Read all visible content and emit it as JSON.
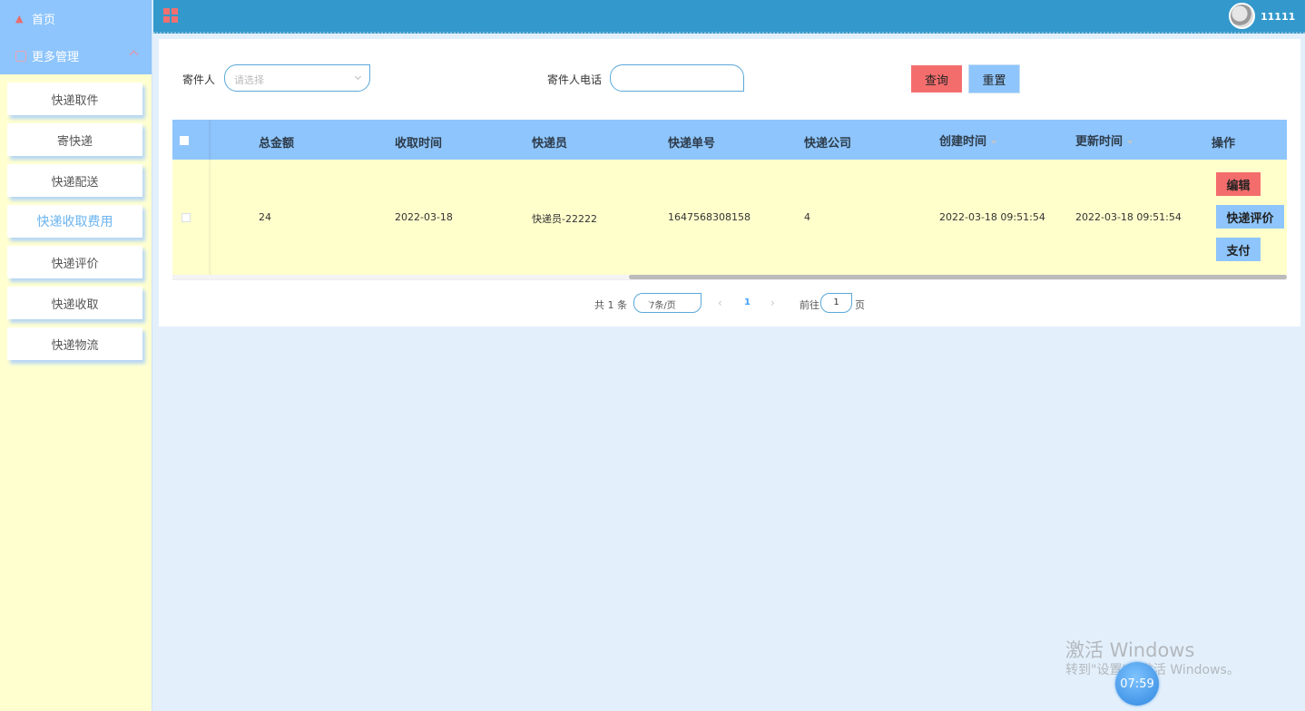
{
  "sidebar": {
    "home": "首页",
    "more": "更多管理",
    "items": [
      {
        "label": "快递取件"
      },
      {
        "label": "寄快递"
      },
      {
        "label": "快递配送"
      },
      {
        "label": "快递收取费用"
      },
      {
        "label": "快递评价"
      },
      {
        "label": "快递收取"
      },
      {
        "label": "快递物流"
      }
    ],
    "active_index": 3
  },
  "topbar": {
    "username": "11111",
    "menu_icon": "grid-icon"
  },
  "filters": {
    "sender_label": "寄件人",
    "sender_placeholder": "请选择",
    "phone_label": "寄件人电话",
    "phone_value": "",
    "search_button": "查询",
    "reset_button": "重置"
  },
  "table": {
    "headers": {
      "total": "总金额",
      "collect_time": "收取时间",
      "courier": "快递员",
      "tracking_no": "快递单号",
      "company": "快递公司",
      "created": "创建时间",
      "updated": "更新时间",
      "ops": "操作"
    },
    "rows": [
      {
        "total": "24",
        "collect_time": "2022-03-18",
        "courier": "快递员-22222",
        "tracking_no": "1647568308158",
        "company": "4",
        "created": "2022-03-18 09:51:54",
        "updated": "2022-03-18 09:51:54",
        "actions": {
          "edit": "编辑",
          "review": "快递评价",
          "pay": "支付"
        }
      }
    ]
  },
  "pagination": {
    "total_text": "共 1 条",
    "page_size": "7条/页",
    "current_page": "1",
    "goto_label": "前往",
    "goto_value": "1",
    "page_suffix": "页"
  },
  "watermark": {
    "line1": "激活 Windows",
    "line2": "转到\"设置\"以激活 Windows。",
    "clock": "07:59"
  },
  "colors": {
    "sidebar_bg": "#ffffd0",
    "sidebar_header": "#8ec5fc",
    "topbar": "#3399cc",
    "danger_button": "#f46d6d",
    "primary_button": "#8ec5fc",
    "table_row": "#ffffcc",
    "page_bg": "#e3f0fc"
  }
}
